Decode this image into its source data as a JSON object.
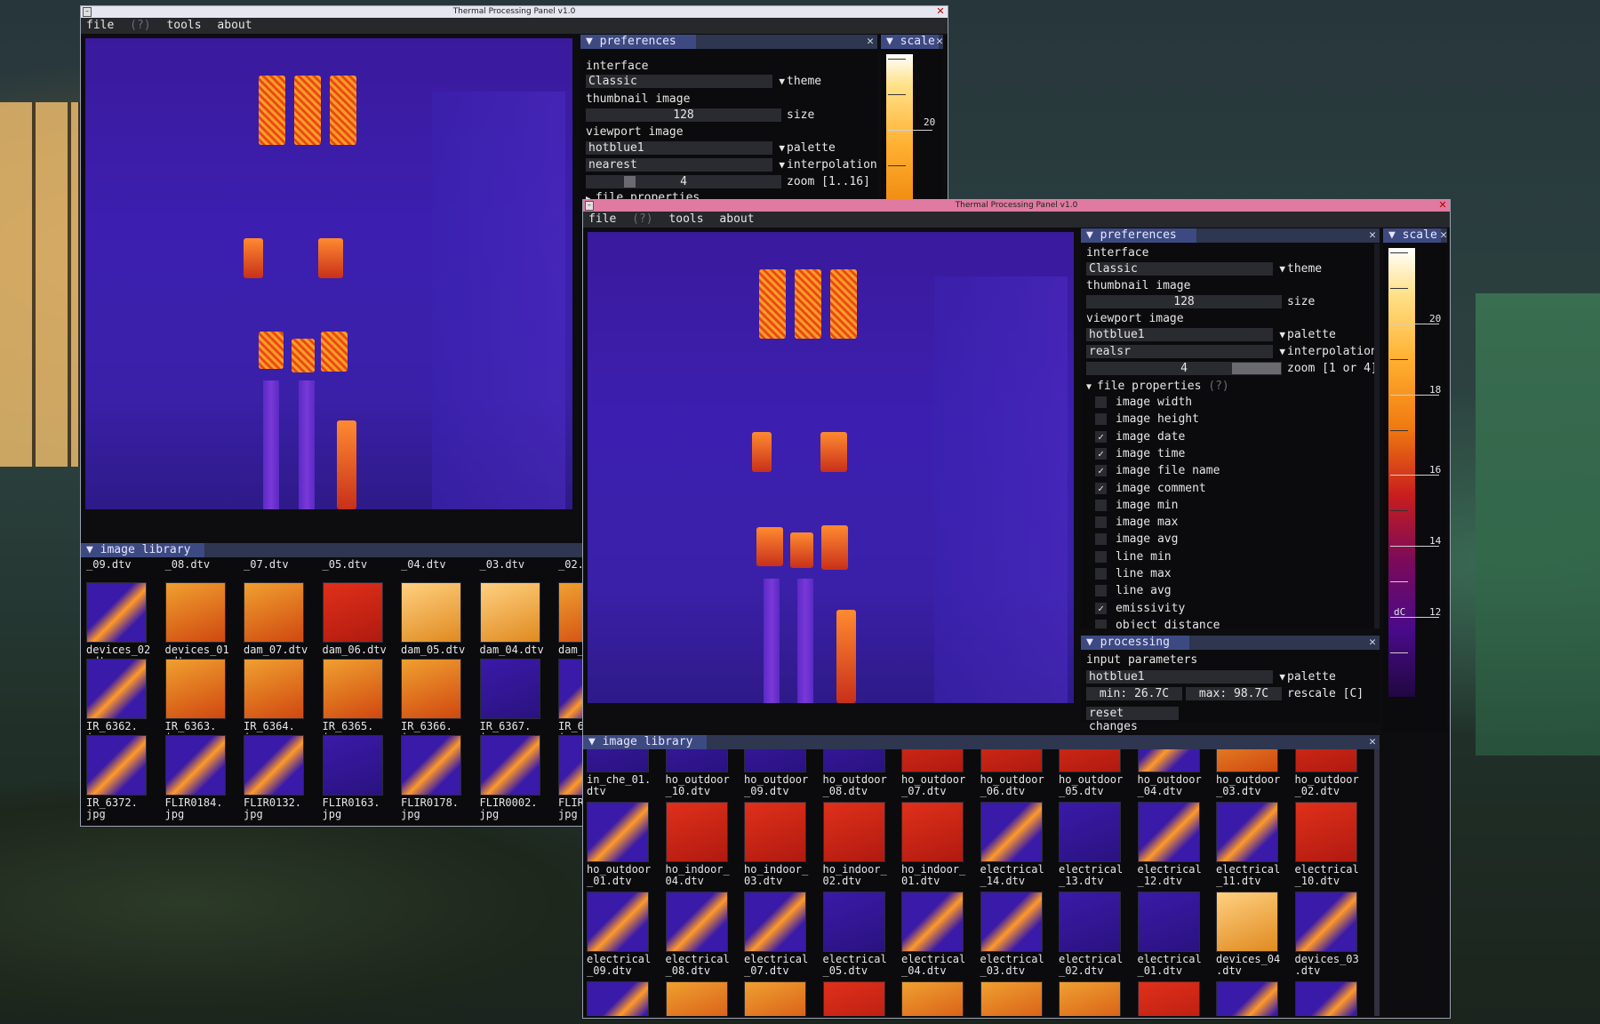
{
  "app_title": "Thermal Processing Panel v1.0",
  "menu": {
    "file": "file",
    "help": "(?)",
    "tools": "tools",
    "about": "about"
  },
  "preferences": {
    "title": "preferences",
    "interface_label": "interface",
    "theme_value": "Classic",
    "theme_label": "theme",
    "thumbnail_label": "thumbnail image",
    "size_value": "128",
    "size_label": "size",
    "viewport_label": "viewport image",
    "palette_value": "hotblue1",
    "palette_label": "palette",
    "interp_label": "interpolation",
    "zoom_value": "4",
    "file_properties": "file properties"
  },
  "back_window": {
    "interp_value": "nearest",
    "zoom_label": "zoom [1..16]"
  },
  "front_window": {
    "interp_value": "realsr",
    "zoom_label": "zoom [1 or 4]",
    "file_properties_help": "(?)",
    "properties": [
      {
        "label": "image width",
        "checked": false
      },
      {
        "label": "image height",
        "checked": false
      },
      {
        "label": "image date",
        "checked": true
      },
      {
        "label": "image time",
        "checked": true
      },
      {
        "label": "image file name",
        "checked": true
      },
      {
        "label": "image comment",
        "checked": true
      },
      {
        "label": "image min",
        "checked": false
      },
      {
        "label": "image max",
        "checked": false
      },
      {
        "label": "image avg",
        "checked": false
      },
      {
        "label": "line min",
        "checked": false
      },
      {
        "label": "line max",
        "checked": false
      },
      {
        "label": "line avg",
        "checked": false
      },
      {
        "label": "emissivity",
        "checked": true
      },
      {
        "label": "object distance",
        "checked": false
      }
    ]
  },
  "processing": {
    "title": "processing",
    "input_params": "input parameters",
    "palette_value": "hotblue1",
    "palette_label": "palette",
    "min_value": "min: 26.7C",
    "max_value": "max: 98.7C",
    "rescale_label": "rescale [C]",
    "reset_button": "reset changes"
  },
  "scale": {
    "title": "scale",
    "back_labels": [
      "20"
    ],
    "front_labels": [
      "20",
      "18",
      "16",
      "14",
      "12"
    ],
    "unit": "dC"
  },
  "library": {
    "title": "image library",
    "back_top_row": [
      "_09.dtv",
      "_08.dtv",
      "_07.dtv",
      "_05.dtv",
      "_04.dtv",
      "_03.dtv",
      "_02."
    ],
    "back_rows": [
      [
        {
          "label": "devices_02\n.dtv",
          "color": "mixed"
        },
        {
          "label": "devices_01\n.dtv",
          "color": "orange"
        },
        {
          "label": "dam_07.dtv",
          "color": "orange"
        },
        {
          "label": "dam_06.dtv",
          "color": "red"
        },
        {
          "label": "dam_05.dtv",
          "color": "yellow"
        },
        {
          "label": "dam_04.dtv",
          "color": "yellow"
        },
        {
          "label": "dam_",
          "color": "orange"
        }
      ],
      [
        {
          "label": "IR_6362.\njpg",
          "color": "mixed"
        },
        {
          "label": "IR_6363.\njpg",
          "color": "orange"
        },
        {
          "label": "IR_6364.\njpg",
          "color": "orange"
        },
        {
          "label": "IR_6365.\njpg",
          "color": "orange"
        },
        {
          "label": "IR_6366.\njpg",
          "color": "orange"
        },
        {
          "label": "IR_6367.\njpg",
          "color": "purple"
        },
        {
          "label": "IR_6\njpg",
          "color": "mixed"
        }
      ],
      [
        {
          "label": "IR_6372.\njpg",
          "color": "mixed"
        },
        {
          "label": "FLIR0184.\njpg",
          "color": "mixed"
        },
        {
          "label": "FLIR0132.\njpg",
          "color": "mixed"
        },
        {
          "label": "FLIR0163.\njpg",
          "color": "purple"
        },
        {
          "label": "FLIR0178.\njpg",
          "color": "mixed"
        },
        {
          "label": "FLIR0002.\njpg",
          "color": "mixed"
        },
        {
          "label": "FLIR\njpg",
          "color": "mixed"
        }
      ]
    ],
    "front_rows": [
      [
        {
          "label": "in_che_01.\ndtv",
          "color": "purple"
        },
        {
          "label": "ho_outdoor\n_10.dtv",
          "color": "purple"
        },
        {
          "label": "ho_outdoor\n_09.dtv",
          "color": "purple"
        },
        {
          "label": "ho_outdoor\n_08.dtv",
          "color": "purple"
        },
        {
          "label": "ho_outdoor\n_07.dtv",
          "color": "red"
        },
        {
          "label": "ho_outdoor\n_06.dtv",
          "color": "red"
        },
        {
          "label": "ho_outdoor\n_05.dtv",
          "color": "red"
        },
        {
          "label": "ho_outdoor\n_04.dtv",
          "color": "mixed"
        },
        {
          "label": "ho_outdoor\n_03.dtv",
          "color": "orange"
        },
        {
          "label": "ho_outdoor\n_02.dtv",
          "color": "red"
        }
      ],
      [
        {
          "label": "ho_outdoor\n_01.dtv",
          "color": "mixed"
        },
        {
          "label": "ho_indoor_\n04.dtv",
          "color": "red"
        },
        {
          "label": "ho_indoor_\n03.dtv",
          "color": "red"
        },
        {
          "label": "ho_indoor_\n02.dtv",
          "color": "red"
        },
        {
          "label": "ho_indoor_\n01.dtv",
          "color": "red"
        },
        {
          "label": "electrical\n_14.dtv",
          "color": "mixed"
        },
        {
          "label": "electrical\n_13.dtv",
          "color": "purple"
        },
        {
          "label": "electrical\n_12.dtv",
          "color": "mixed"
        },
        {
          "label": "electrical\n_11.dtv",
          "color": "mixed"
        },
        {
          "label": "electrical\n_10.dtv",
          "color": "red"
        }
      ],
      [
        {
          "label": "electrical\n_09.dtv",
          "color": "mixed"
        },
        {
          "label": "electrical\n_08.dtv",
          "color": "mixed"
        },
        {
          "label": "electrical\n_07.dtv",
          "color": "mixed"
        },
        {
          "label": "electrical\n_05.dtv",
          "color": "purple"
        },
        {
          "label": "electrical\n_04.dtv",
          "color": "mixed"
        },
        {
          "label": "electrical\n_03.dtv",
          "color": "mixed"
        },
        {
          "label": "electrical\n_02.dtv",
          "color": "purple"
        },
        {
          "label": "electrical\n_01.dtv",
          "color": "purple"
        },
        {
          "label": "devices_04\n.dtv",
          "color": "yellow"
        },
        {
          "label": "devices_03\n.dtv",
          "color": "mixed"
        }
      ],
      [
        {
          "label": "",
          "color": "mixed"
        },
        {
          "label": "",
          "color": "orange"
        },
        {
          "label": "",
          "color": "orange"
        },
        {
          "label": "",
          "color": "red"
        },
        {
          "label": "",
          "color": "orange"
        },
        {
          "label": "",
          "color": "orange"
        },
        {
          "label": "",
          "color": "orange"
        },
        {
          "label": "",
          "color": "red"
        },
        {
          "label": "",
          "color": "mixed"
        },
        {
          "label": "",
          "color": "mixed"
        }
      ]
    ]
  },
  "colors": {
    "titlebar_back": "#e6e6f0",
    "titlebar_front": "#e07aa0",
    "panel_tab": "#3d4a82",
    "panel_head": "#2e3650"
  }
}
